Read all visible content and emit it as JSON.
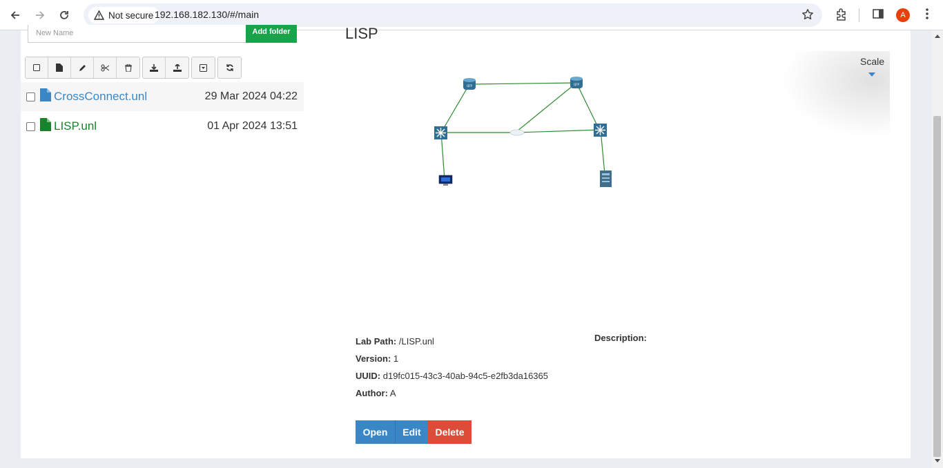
{
  "browser": {
    "security_label": "Not secure",
    "url": "192.168.182.130/#/main",
    "profile_initial": "A"
  },
  "folder_form": {
    "new_name_placeholder": "New  Name",
    "add_folder_label": "Add folder"
  },
  "toolbar": {
    "icons": [
      "select-all-icon",
      "new-file-icon",
      "rename-icon",
      "cut-icon",
      "delete-icon",
      "import-icon",
      "export-icon",
      "move-icon",
      "refresh-icon"
    ]
  },
  "files": [
    {
      "name": "CrossConnect.unl",
      "date": "29 Mar 2024 04:22",
      "color": "#3a87c8"
    },
    {
      "name": "LISP.unl",
      "date": "01 Apr 2024 13:51",
      "color": "#17842c"
    }
  ],
  "lab": {
    "title": "LISP",
    "scale_label": "Scale",
    "path_label": "Lab Path:",
    "path_value": "/LISP.unl",
    "version_label": "Version:",
    "version_value": "1",
    "uuid_label": "UUID:",
    "uuid_value": "d19fc015-43c3-40ab-94c5-e2fb3da16365",
    "author_label": "Author:",
    "author_value": "A",
    "description_label": "Description:",
    "open_label": "Open",
    "edit_label": "Edit",
    "delete_label": "Delete"
  },
  "colors": {
    "open": "#3a87c8",
    "edit": "#3a87c8",
    "delete": "#dd4b39",
    "add_folder": "#1aa34a",
    "link": "#138a36"
  }
}
